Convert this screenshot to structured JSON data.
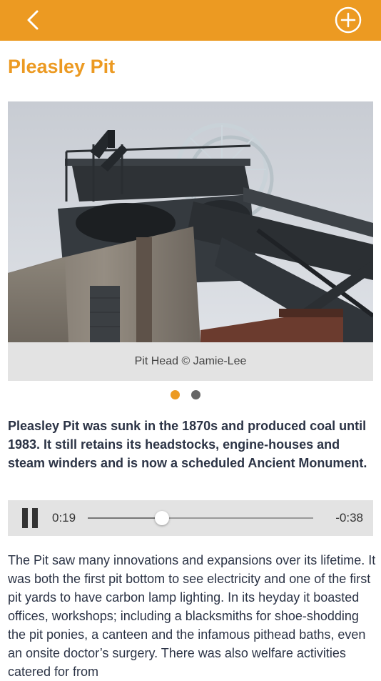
{
  "header": {
    "back_icon": "chevron-left-icon",
    "add_icon": "plus-circle-icon",
    "bar_color": "#ec9a22"
  },
  "page": {
    "title": "Pleasley Pit"
  },
  "gallery": {
    "image_caption": "Pit Head © Jamie-Lee",
    "page_count": 2,
    "active_index": 0,
    "active_dot_color": "#ec9a22",
    "inactive_dot_color": "#666666"
  },
  "intro": {
    "text": "Pleasley Pit was sunk in the 1870s and produced coal until 1983. It still retains its headstocks, engine-houses and steam winders and is now a scheduled Ancient Monument."
  },
  "audio": {
    "state_icon": "pause-icon",
    "elapsed": "0:19",
    "remaining": "-0:38",
    "progress": 0.33
  },
  "body": {
    "text": "The Pit saw many innovations and expansions over its lifetime. It was both the first pit bottom to see electricity and one of the first pit yards to have carbon lamp lighting. In its heyday it boasted offices, workshops; including a blacksmiths for shoe-shodding the pit ponies, a canteen and the infamous pithead baths, even an onsite doctor’s surgery. There was also welfare activities catered for from"
  }
}
